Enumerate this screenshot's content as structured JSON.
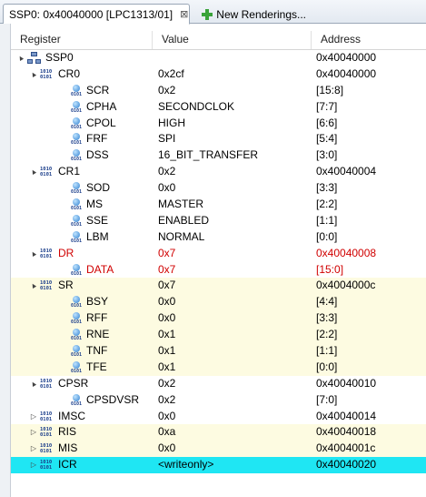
{
  "tabs": [
    {
      "label": "SSP0: 0x40040000 [LPC1313/01]",
      "active": true,
      "close": "⊠"
    },
    {
      "label": "New Renderings...",
      "active": false
    }
  ],
  "columns": {
    "register": "Register",
    "value": "Value",
    "address": "Address"
  },
  "rows": [
    {
      "level": 0,
      "kind": "periph",
      "expand": "▲",
      "name": "SSP0",
      "value": "",
      "address": "0x40040000",
      "style": ""
    },
    {
      "level": 1,
      "kind": "reg",
      "expand": "▲",
      "name": "CR0",
      "value": "0x2cf",
      "address": "0x40040000",
      "style": ""
    },
    {
      "level": 2,
      "kind": "field",
      "expand": "",
      "name": "SCR",
      "value": "0x2",
      "address": "[15:8]",
      "style": ""
    },
    {
      "level": 2,
      "kind": "field",
      "expand": "",
      "name": "CPHA",
      "value": "SECONDCLOK",
      "address": "[7:7]",
      "style": ""
    },
    {
      "level": 2,
      "kind": "field",
      "expand": "",
      "name": "CPOL",
      "value": "HIGH",
      "address": "[6:6]",
      "style": ""
    },
    {
      "level": 2,
      "kind": "field",
      "expand": "",
      "name": "FRF",
      "value": "SPI",
      "address": "[5:4]",
      "style": ""
    },
    {
      "level": 2,
      "kind": "field",
      "expand": "",
      "name": "DSS",
      "value": "16_BIT_TRANSFER",
      "address": "[3:0]",
      "style": ""
    },
    {
      "level": 1,
      "kind": "reg",
      "expand": "▲",
      "name": "CR1",
      "value": "0x2",
      "address": "0x40040004",
      "style": ""
    },
    {
      "level": 2,
      "kind": "field",
      "expand": "",
      "name": "SOD",
      "value": "0x0",
      "address": "[3:3]",
      "style": ""
    },
    {
      "level": 2,
      "kind": "field",
      "expand": "",
      "name": "MS",
      "value": "MASTER",
      "address": "[2:2]",
      "style": ""
    },
    {
      "level": 2,
      "kind": "field",
      "expand": "",
      "name": "SSE",
      "value": "ENABLED",
      "address": "[1:1]",
      "style": ""
    },
    {
      "level": 2,
      "kind": "field",
      "expand": "",
      "name": "LBM",
      "value": "NORMAL",
      "address": "[0:0]",
      "style": ""
    },
    {
      "level": 1,
      "kind": "reg",
      "expand": "▲",
      "name": "DR",
      "value": "0x7",
      "address": "0x40040008",
      "style": "red"
    },
    {
      "level": 2,
      "kind": "field",
      "expand": "",
      "name": "DATA",
      "value": "0x7",
      "address": "[15:0]",
      "style": "red"
    },
    {
      "level": 1,
      "kind": "reg",
      "expand": "▲",
      "name": "SR",
      "value": "0x7",
      "address": "0x4004000c",
      "style": "yellow"
    },
    {
      "level": 2,
      "kind": "field",
      "expand": "",
      "name": "BSY",
      "value": "0x0",
      "address": "[4:4]",
      "style": "yellow"
    },
    {
      "level": 2,
      "kind": "field",
      "expand": "",
      "name": "RFF",
      "value": "0x0",
      "address": "[3:3]",
      "style": "yellow"
    },
    {
      "level": 2,
      "kind": "field",
      "expand": "",
      "name": "RNE",
      "value": "0x1",
      "address": "[2:2]",
      "style": "yellow"
    },
    {
      "level": 2,
      "kind": "field",
      "expand": "",
      "name": "TNF",
      "value": "0x1",
      "address": "[1:1]",
      "style": "yellow"
    },
    {
      "level": 2,
      "kind": "field",
      "expand": "",
      "name": "TFE",
      "value": "0x1",
      "address": "[0:0]",
      "style": "yellow"
    },
    {
      "level": 1,
      "kind": "reg",
      "expand": "▲",
      "name": "CPSR",
      "value": "0x2",
      "address": "0x40040010",
      "style": ""
    },
    {
      "level": 2,
      "kind": "field",
      "expand": "",
      "name": "CPSDVSR",
      "value": "0x2",
      "address": "[7:0]",
      "style": ""
    },
    {
      "level": 1,
      "kind": "reg",
      "expand": "▷",
      "name": "IMSC",
      "value": "0x0",
      "address": "0x40040014",
      "style": ""
    },
    {
      "level": 1,
      "kind": "reg",
      "expand": "▷",
      "name": "RIS",
      "value": "0xa",
      "address": "0x40040018",
      "style": "yellow"
    },
    {
      "level": 1,
      "kind": "reg",
      "expand": "▷",
      "name": "MIS",
      "value": "0x0",
      "address": "0x4004001c",
      "style": "yellow"
    },
    {
      "level": 1,
      "kind": "reg",
      "expand": "▷",
      "name": "ICR",
      "value": "<writeonly>",
      "address": "0x40040020",
      "style": "cyan"
    }
  ],
  "colors": {
    "highlight_cyan": "#1fe6f3",
    "changed_yellow": "#fdfbe1",
    "changed_red": "#d00000"
  }
}
